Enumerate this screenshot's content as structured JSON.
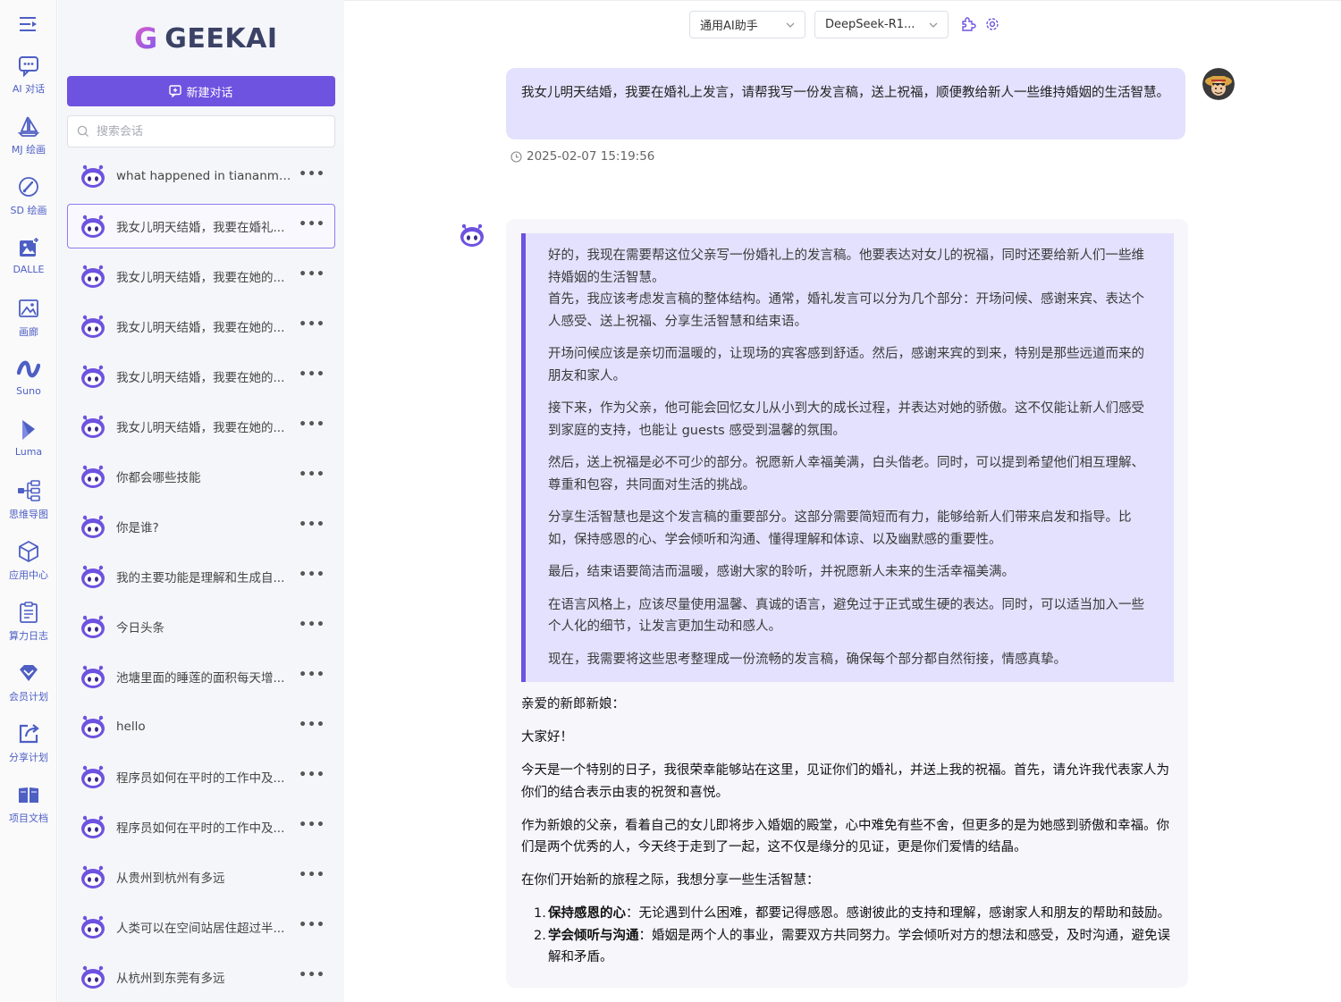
{
  "nav": {
    "items": [
      {
        "label": "AI 对话",
        "icon": "chat-icon"
      },
      {
        "label": "MJ 绘画",
        "icon": "sailboat-icon"
      },
      {
        "label": "SD 绘画",
        "icon": "brush-icon"
      },
      {
        "label": "DALLE",
        "icon": "image-add-icon"
      },
      {
        "label": "画廊",
        "icon": "gallery-icon"
      },
      {
        "label": "Suno",
        "icon": "wave-icon"
      },
      {
        "label": "Luma",
        "icon": "luma-icon"
      },
      {
        "label": "思维导图",
        "icon": "mindmap-icon"
      },
      {
        "label": "应用中心",
        "icon": "cube-icon"
      },
      {
        "label": "算力日志",
        "icon": "clipboard-icon"
      },
      {
        "label": "会员计划",
        "icon": "diamond-icon"
      },
      {
        "label": "分享计划",
        "icon": "share-icon"
      },
      {
        "label": "项目文档",
        "icon": "book-icon"
      }
    ]
  },
  "sidebar": {
    "logo_mark": "G",
    "logo_text": "GEEKAI",
    "new_chat_label": "新建对话",
    "search_placeholder": "搜索会话",
    "chats": [
      {
        "title": "what happened in tiananme..."
      },
      {
        "title": "我女儿明天结婚，我要在婚礼..."
      },
      {
        "title": "我女儿明天结婚，我要在她的..."
      },
      {
        "title": "我女儿明天结婚，我要在她的..."
      },
      {
        "title": "我女儿明天结婚，我要在她的..."
      },
      {
        "title": "我女儿明天结婚，我要在她的..."
      },
      {
        "title": "你都会哪些技能"
      },
      {
        "title": "你是谁?"
      },
      {
        "title": "我的主要功能是理解和生成自..."
      },
      {
        "title": "今日头条"
      },
      {
        "title": "池塘里面的睡莲的面积每天增..."
      },
      {
        "title": "hello"
      },
      {
        "title": "程序员如何在平时的工作中及..."
      },
      {
        "title": "程序员如何在平时的工作中及..."
      },
      {
        "title": "从贵州到杭州有多远"
      },
      {
        "title": "人类可以在空间站居住超过半..."
      },
      {
        "title": "从杭州到东莞有多远"
      }
    ],
    "more_label": "•••"
  },
  "header": {
    "role_select": "通用AI助手",
    "model_select": "DeepSeek-R1..."
  },
  "conversation": {
    "user_message": "我女儿明天结婚，我要在婚礼上发言，请帮我写一份发言稿，送上祝福，顺便教给新人一些维持婚姻的生活智慧。",
    "user_time": "2025-02-07 15:19:56",
    "thinking": [
      "好的，我现在需要帮这位父亲写一份婚礼上的发言稿。他要表达对女儿的祝福，同时还要给新人们一些维持婚姻的生活智慧。",
      "首先，我应该考虑发言稿的整体结构。通常，婚礼发言可以分为几个部分：开场问候、感谢来宾、表达个人感受、送上祝福、分享生活智慧和结束语。",
      "开场问候应该是亲切而温暖的，让现场的宾客感到舒适。然后，感谢来宾的到来，特别是那些远道而来的朋友和家人。",
      "接下来，作为父亲，他可能会回忆女儿从小到大的成长过程，并表达对她的骄傲。这不仅能让新人们感受到家庭的支持，也能让 guests 感受到温馨的氛围。",
      "然后，送上祝福是必不可少的部分。祝愿新人幸福美满，白头偕老。同时，可以提到希望他们相互理解、尊重和包容，共同面对生活的挑战。",
      "分享生活智慧也是这个发言稿的重要部分。这部分需要简短而有力，能够给新人们带来启发和指导。比如，保持感恩的心、学会倾听和沟通、懂得理解和体谅、以及幽默感的重要性。",
      "最后，结束语要简洁而温暖，感谢大家的聆听，并祝愿新人未来的生活幸福美满。",
      "在语言风格上，应该尽量使用温馨、真诚的语言，避免过于正式或生硬的表达。同时，可以适当加入一些个人化的细节，让发言更加生动和感人。",
      "现在，我需要将这些思考整理成一份流畅的发言稿，确保每个部分都自然衔接，情感真挚。"
    ],
    "answer": {
      "greeting": "亲爱的新郎新娘：",
      "hello": "大家好！",
      "p1": "今天是一个特别的日子，我很荣幸能够站在这里，见证你们的婚礼，并送上我的祝福。首先，请允许我代表家人为你们的结合表示由衷的祝贺和喜悦。",
      "p2": "作为新娘的父亲，看着自己的女儿即将步入婚姻的殿堂，心中难免有些不舍，但更多的是为她感到骄傲和幸福。你们是两个优秀的人，今天终于走到了一起，这不仅是缘分的见证，更是你们爱情的结晶。",
      "p3": "在你们开始新的旅程之际，我想分享一些生活智慧：",
      "list": [
        {
          "num": "1.",
          "head": "保持感恩的心",
          "body": "：无论遇到什么困难，都要记得感恩。感谢彼此的支持和理解，感谢家人和朋友的帮助和鼓励。"
        },
        {
          "num": "2.",
          "head": "学会倾听与沟通",
          "body": "：婚姻是两个人的事业，需要双方共同努力。学会倾听对方的想法和感受，及时沟通，避免误解和矛盾。"
        }
      ]
    }
  },
  "colors": {
    "accent": "#6e52e0",
    "bubble": "#e3e1fd",
    "nav_text": "#4e5fc4"
  }
}
